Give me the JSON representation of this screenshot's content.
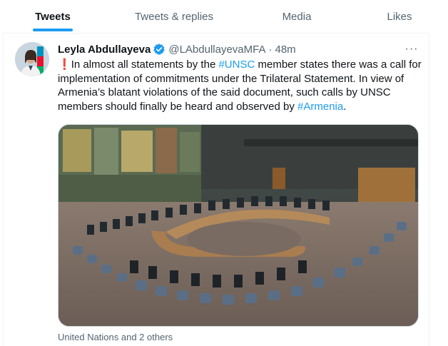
{
  "tabs": [
    {
      "label": "Tweets",
      "active": true
    },
    {
      "label": "Tweets & replies",
      "active": false
    },
    {
      "label": "Media",
      "active": false
    },
    {
      "label": "Likes",
      "active": false
    }
  ],
  "tweet": {
    "author_name": "Leyla Abdullayeva",
    "handle": "@LAbdullayevaMFA",
    "separator": "·",
    "time": "48m",
    "more_glyph": "···",
    "text_line_1_pre": "In almost all statements by the ",
    "text_hashtag_unsc": "#UNSC",
    "text_line_1_post": " member states there was a call for implementation of commitments under the Trilateral Statement. In view of Armenia’s blatant violations of the said document, such calls by UNSC members should finally be heard and observed by ",
    "text_hashtag_armenia": "#Armenia",
    "text_end": ".",
    "exclamation_glyph": "❗",
    "photo_tags": "United Nations and 2 others"
  },
  "colors": {
    "accent": "#1d9bf0",
    "text": "#0f1419",
    "secondary_text": "#536471",
    "exclamation": "#e0245e"
  },
  "icons": {
    "verified": "verified-badge-icon",
    "more": "more-options-icon"
  }
}
